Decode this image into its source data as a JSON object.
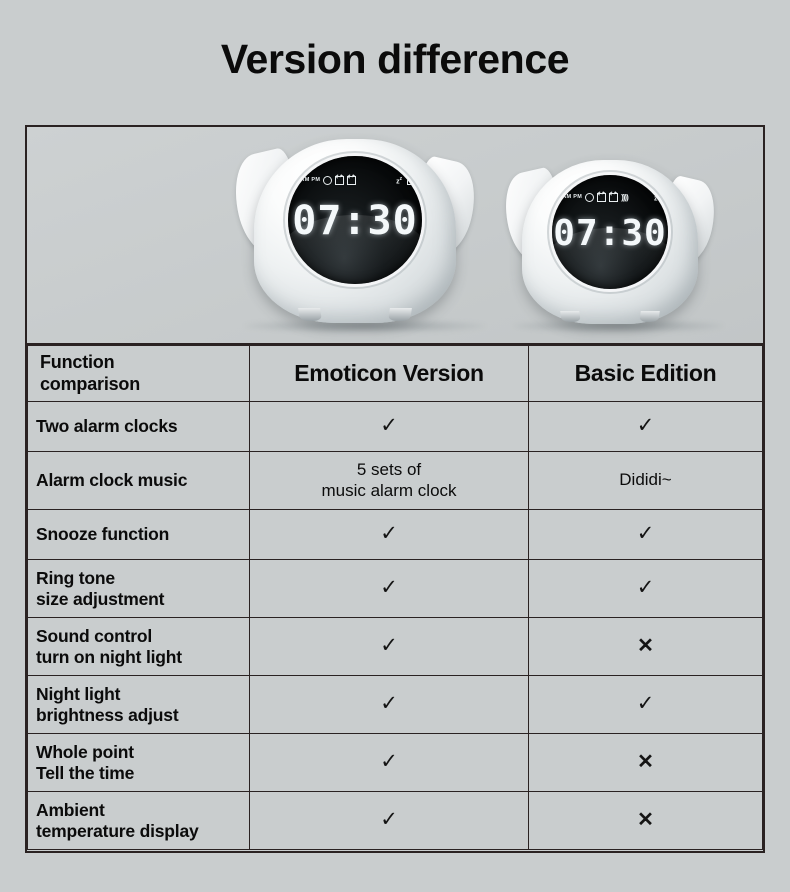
{
  "page": {
    "title": "Version difference",
    "background_color": "#c9cdce",
    "border_color": "#2a2222",
    "text_color": "#0b0b0b"
  },
  "product_images": {
    "left": {
      "name": "Emoticon Version alarm clock",
      "display_time": "07:30",
      "indicators": [
        "AM",
        "PM",
        "clock-icon",
        "alarm-1-icon",
        "alarm-2-icon",
        "sleep-zz-icon",
        "battery-icon"
      ]
    },
    "right": {
      "name": "Basic Edition alarm clock",
      "display_time": "07:30",
      "indicators": [
        "AM",
        "PM",
        "clock-icon",
        "alarm-1-icon",
        "alarm-2-icon",
        "sound-wave-icon",
        "sleep-zz-icon"
      ]
    }
  },
  "table": {
    "headers": {
      "feature": "Function\ncomparison",
      "col_a": "Emoticon Version",
      "col_b": "Basic Edition"
    },
    "check_glyph": "✓",
    "cross_glyph": "✕",
    "rows": [
      {
        "feature": "Two alarm clocks",
        "a": "✓",
        "b": "✓",
        "a_type": "mark",
        "b_type": "mark"
      },
      {
        "feature": "Alarm clock music",
        "a": "5 sets of\nmusic alarm clock",
        "b": "Dididi~",
        "a_type": "text",
        "b_type": "text"
      },
      {
        "feature": "Snooze function",
        "a": "✓",
        "b": "✓",
        "a_type": "mark",
        "b_type": "mark"
      },
      {
        "feature": "Ring tone\nsize adjustment",
        "a": "✓",
        "b": "✓",
        "a_type": "mark",
        "b_type": "mark"
      },
      {
        "feature": "Sound control\nturn on night light",
        "a": "✓",
        "b": "✕",
        "a_type": "mark",
        "b_type": "cross"
      },
      {
        "feature": "Night light\nbrightness adjust",
        "a": "✓",
        "b": "✓",
        "a_type": "mark",
        "b_type": "mark"
      },
      {
        "feature": "Whole point\nTell the time",
        "a": "✓",
        "b": "✕",
        "a_type": "mark",
        "b_type": "cross"
      },
      {
        "feature": "Ambient\ntemperature display",
        "a": "✓",
        "b": "✕",
        "a_type": "mark",
        "b_type": "cross"
      }
    ]
  }
}
